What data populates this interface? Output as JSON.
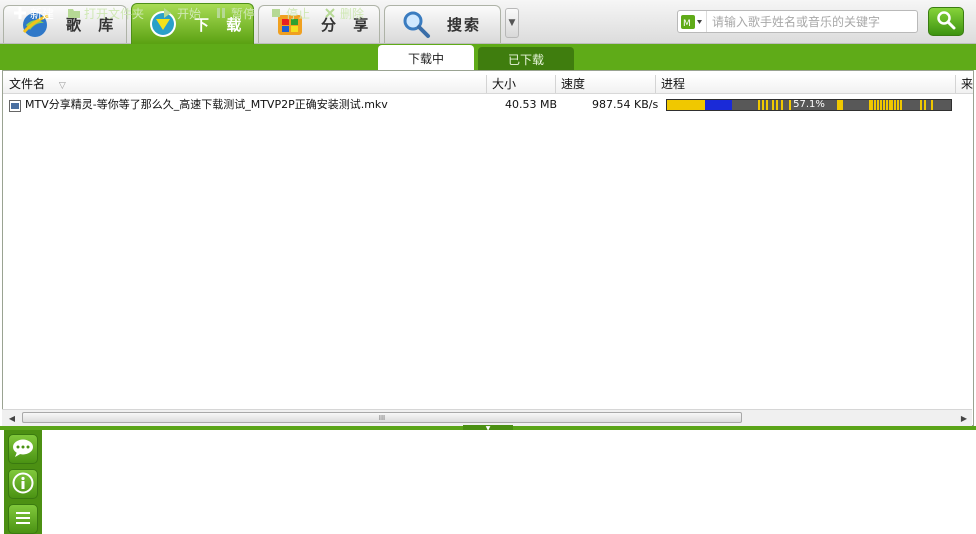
{
  "nav": {
    "tabs": [
      {
        "label": "歌 库",
        "icon": "library-globe-icon",
        "active": false
      },
      {
        "label": "下 载",
        "icon": "download-icon",
        "active": true
      },
      {
        "label": "分 享",
        "icon": "share-icon",
        "active": false
      },
      {
        "label": "搜索",
        "icon": "search-magnifier-icon",
        "active": false
      }
    ],
    "more_icon": "chevron-down-icon"
  },
  "search": {
    "placeholder": "请输入歌手姓名或音乐的关键字",
    "source_icon": "mtv-source-icon",
    "button_icon": "search-icon"
  },
  "toolbar": {
    "items": [
      {
        "label": "新建",
        "icon": "plus-icon",
        "enabled": true
      },
      {
        "label": "打开文件夹",
        "icon": "folder-icon",
        "enabled": false
      },
      {
        "label": "开始",
        "icon": "play-icon",
        "enabled": false
      },
      {
        "label": "暂停",
        "icon": "pause-icon",
        "enabled": false
      },
      {
        "label": "停止",
        "icon": "stop-icon",
        "enabled": false
      },
      {
        "label": "删除",
        "icon": "delete-icon",
        "enabled": false
      }
    ],
    "subtabs": [
      {
        "label": "下载中",
        "active": true
      },
      {
        "label": "已下载",
        "active": false
      }
    ]
  },
  "table": {
    "columns": [
      "文件名",
      "大小",
      "速度",
      "进程",
      "来源"
    ],
    "sort_indicator": "▽",
    "rows": [
      {
        "file_icon": "video-file-icon",
        "filename": "MTV分享精灵-等你等了那么久_高速下载测试_MTVP2P正确安装测试.mkv",
        "size": "40.53 MB",
        "speed": "987.54 KB/s",
        "progress_text": "57.1%",
        "progress": 0.571
      }
    ]
  },
  "scrollbar": {
    "grip": "III"
  },
  "side_panel": {
    "icons": [
      "chat-bubble-icon",
      "info-icon",
      "list-icon"
    ]
  },
  "colors": {
    "brand_green": "#5fab18",
    "progress_yellow": "#f0c800",
    "progress_blue": "#1a2ad8"
  }
}
